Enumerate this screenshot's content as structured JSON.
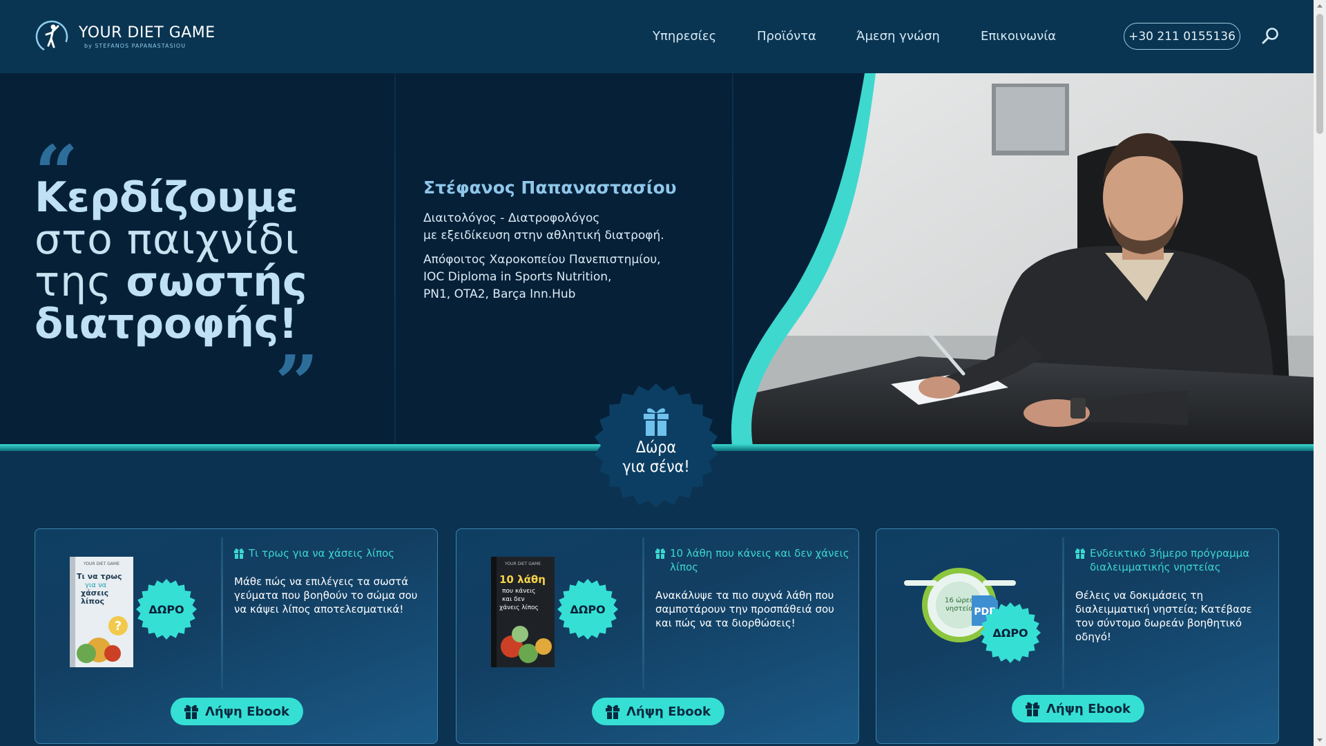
{
  "brand": {
    "title": "YOUR DIET GAME",
    "subtitle": "by STEFANOS PAPANASTASIOU"
  },
  "nav": {
    "items": [
      "Υπηρεσίες",
      "Προϊόντα",
      "Άμεση γνώση",
      "Επικοινωνία"
    ],
    "phone": "+30 211 0155136"
  },
  "hero": {
    "headline": {
      "line1": "Κερδίζουμε",
      "line2": "στο παιχνίδι",
      "line3_light": "της ",
      "line3_bold": "σωστής",
      "line4": "διατροφής!"
    },
    "name": "Στέφανος Παπαναστασίου",
    "bio1_line1": "Διαιτολόγος - Διατροφολόγος",
    "bio1_line2": "με εξειδίκευση στην αθλητική διατροφή.",
    "bio2_line1": "Απόφοιτος Χαροκοπείου Πανεπιστημίου,",
    "bio2_line2": "IOC Diploma in Sports Nutrition,",
    "bio2_line3": "PN1, OTA2, Barça Inn.Hub"
  },
  "gift_badge": {
    "line1": "Δώρα",
    "line2": "για σένα!"
  },
  "cards": [
    {
      "title": "Τι τρως για να χάσεις λίπος",
      "description": "Μάθε πώς να επιλέγεις τα σωστά γεύματα που βοηθούν το σώμα σου να κάψει λίπος αποτελεσματικά!",
      "button": "Λήψη Ebook",
      "badge": "ΔΩΡΟ",
      "book_brand": "YOUR DIET GAME",
      "book_title_1": "Τι να τρως",
      "book_title_2": "για να",
      "book_title_3": "χάσεις",
      "book_title_4": "λίπος"
    },
    {
      "title": "10 λάθη που κάνεις και δεν χάνεις λίπος",
      "description": "Ανακάλυψε τα πιο συχνά λάθη που σαμποτάρουν την προσπάθειά σου και πώς να τα διορθώσεις!",
      "button": "Λήψη Ebook",
      "badge": "ΔΩΡΟ",
      "book_brand": "YOUR DIET GAME",
      "book_title_1": "10 λάθη",
      "book_title_2": "που κάνεις",
      "book_title_3": "και δεν",
      "book_title_4": "χάνεις λίπος"
    },
    {
      "title": "Ενδεικτικό 3ήμερο πρόγραμμα διαλειμματικής νηστείας",
      "description": "Θέλεις να δοκιμάσεις τη διαλειμματική νηστεία; Κατέβασε τον σύντομο δωρεάν βοηθητικό οδηγό!",
      "button": "Λήψη Ebook",
      "badge": "ΔΩΡΟ",
      "clock_line1": "16 ώρες",
      "clock_line2": "νηστεία",
      "pdf_label": "PDF"
    }
  ],
  "colors": {
    "accent": "#36dfd4",
    "header_bg": "#0a3552",
    "hero_bg": "#062038",
    "section_bg": "#0b3250"
  }
}
